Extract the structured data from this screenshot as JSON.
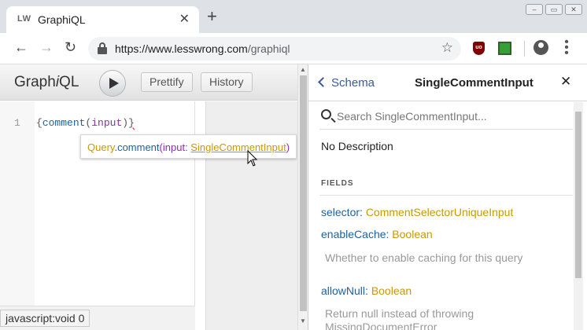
{
  "browser": {
    "tab_favicon": "LW",
    "tab_title": "GraphiQL",
    "tab_close": "✕",
    "new_tab": "+",
    "url_host": "https://www.lesswrong.com",
    "url_path": "/graphiql",
    "ext_ublock_label": "uo"
  },
  "graphiql": {
    "title_a": "Graph",
    "title_b": "i",
    "title_c": "QL",
    "prettify_label": "Prettify",
    "history_label": "History",
    "line_number": "1",
    "code": {
      "open_brace": "{",
      "field": "comment",
      "paren_open": "(",
      "arg": "input",
      "paren_close": ")",
      "close_brace": "}"
    },
    "tooltip": {
      "type": "Query",
      "dot": ".",
      "field": "comment",
      "paren_open": "(",
      "arg": "input: ",
      "arg_type": "SingleCommentInput",
      "paren_close": ")"
    },
    "status_text": "javascript:void 0"
  },
  "docs": {
    "back_label": "Schema",
    "title": "SingleCommentInput",
    "close": "✕",
    "search_placeholder": "Search SingleCommentInput...",
    "no_description": "No Description",
    "fields_header": "FIELDS",
    "fields": [
      {
        "name": "selector",
        "colon": ": ",
        "type": "CommentSelectorUniqueInput",
        "description": ""
      },
      {
        "name": "enableCache",
        "colon": ": ",
        "type": "Boolean",
        "description": "Whether to enable caching for this query"
      },
      {
        "name": "allowNull",
        "colon": ": ",
        "type": "Boolean",
        "description": "Return null instead of throwing MissingDocumentError"
      }
    ]
  }
}
